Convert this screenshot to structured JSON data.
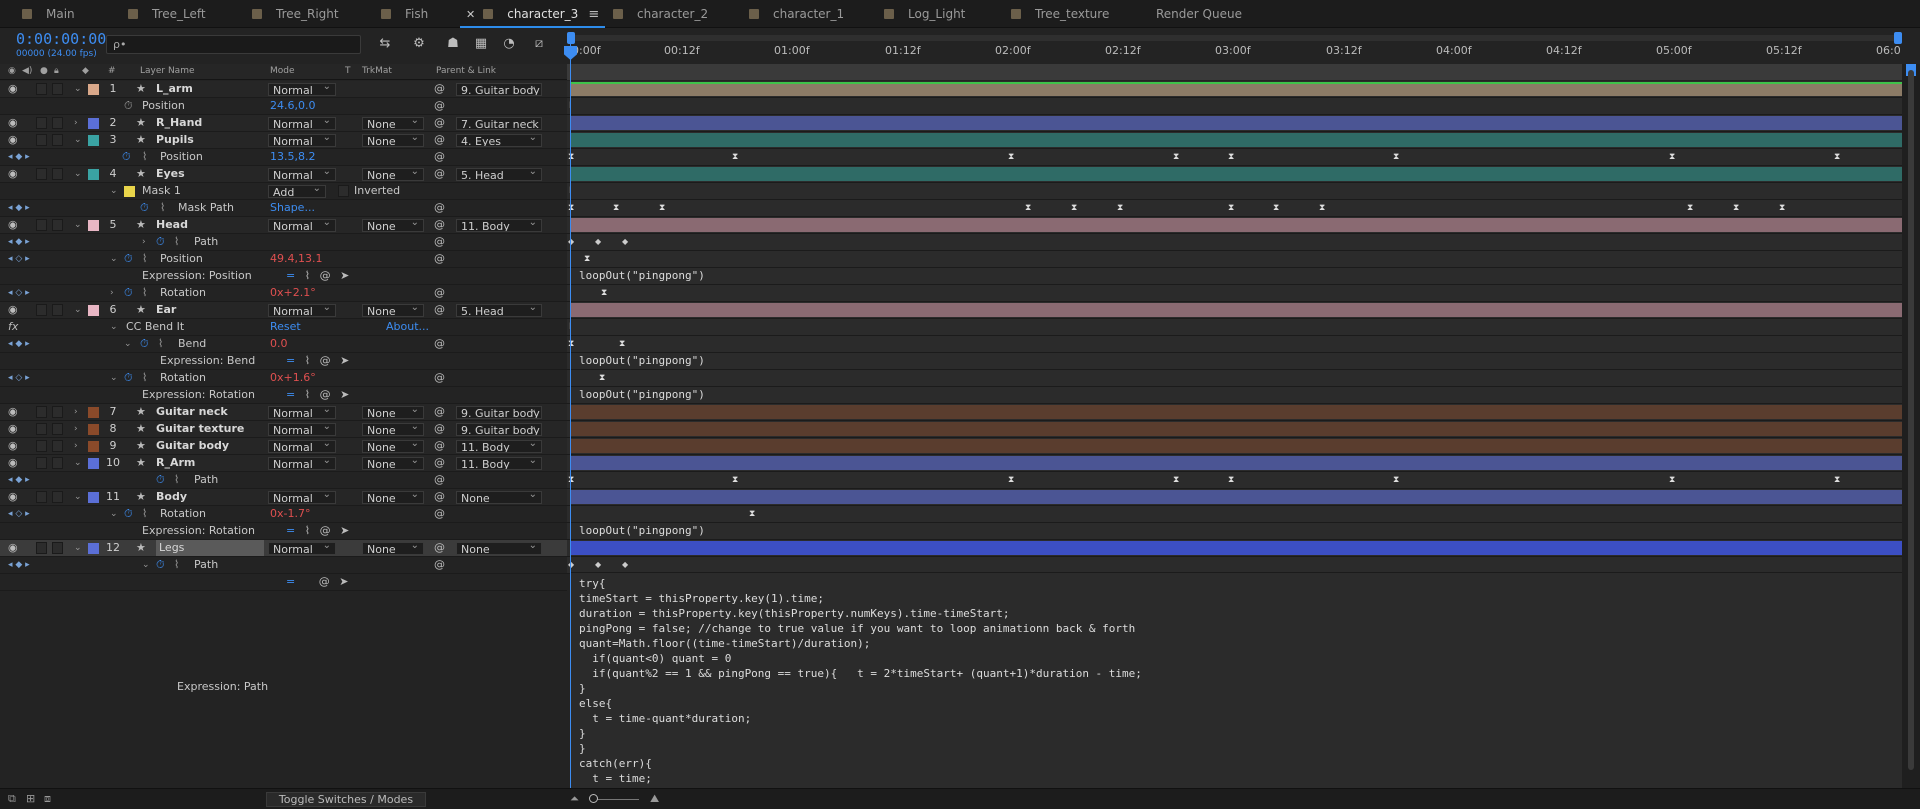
{
  "tabs": [
    {
      "label": "Main"
    },
    {
      "label": "Tree_Left"
    },
    {
      "label": "Tree_Right"
    },
    {
      "label": "Fish"
    },
    {
      "label": "character_3"
    },
    {
      "label": "character_2"
    },
    {
      "label": "character_1"
    },
    {
      "label": "Log_Light"
    },
    {
      "label": "Tree_texture"
    },
    {
      "label": "Render Queue"
    }
  ],
  "header": {
    "timecode": "0:00:00:00",
    "fps": "00000 (24.00 fps)",
    "search_placeholder": "ρ•"
  },
  "columns": {
    "hash": "#",
    "layer_name": "Layer Name",
    "mode": "Mode",
    "t": "T",
    "trkmat": "TrkMat",
    "parent": "Parent & Link"
  },
  "ruler": {
    "ticks": [
      "0:00f",
      "00:12f",
      "01:00f",
      "01:12f",
      "02:00f",
      "02:12f",
      "03:00f",
      "03:12f",
      "04:00f",
      "04:12f",
      "05:00f",
      "05:12f",
      "06:0"
    ]
  },
  "layers": {
    "r1": {
      "num": "1",
      "name": "L_arm",
      "mode": "Normal",
      "parent": "9. Guitar body",
      "color": "#d9a88a"
    },
    "r1p": {
      "name": "Position",
      "value": "24.6,0.0"
    },
    "r2": {
      "num": "2",
      "name": "R_Hand",
      "mode": "Normal",
      "trk": "None",
      "parent": "7. Guitar neck",
      "color": "#5b6fd6"
    },
    "r3": {
      "num": "3",
      "name": "Pupils",
      "mode": "Normal",
      "trk": "None",
      "parent": "4. Eyes",
      "color": "#3aa3a3"
    },
    "r3p": {
      "name": "Position",
      "value": "13.5,8.2"
    },
    "r4": {
      "num": "4",
      "name": "Eyes",
      "mode": "Normal",
      "trk": "None",
      "parent": "5. Head",
      "color": "#3aa3a3"
    },
    "r4m": {
      "name": "Mask 1",
      "mode": "Add",
      "inverted": "Inverted"
    },
    "r4mp": {
      "name": "Mask Path",
      "value": "Shape..."
    },
    "r5": {
      "num": "5",
      "name": "Head",
      "mode": "Normal",
      "trk": "None",
      "parent": "11. Body",
      "color": "#e8b6c4"
    },
    "r5a": {
      "name": "Path"
    },
    "r5b": {
      "name": "Position",
      "value": "49.4,13.1"
    },
    "r5c": {
      "label": "Expression: Position"
    },
    "r5d": {
      "name": "Rotation",
      "value": "0x+2.1°"
    },
    "r6": {
      "num": "6",
      "name": "Ear",
      "mode": "Normal",
      "trk": "None",
      "parent": "5. Head",
      "color": "#e8b6c4"
    },
    "r6fx": {
      "name": "CC Bend It",
      "reset": "Reset",
      "about": "About..."
    },
    "r6a": {
      "name": "Bend",
      "value": "0.0"
    },
    "r6b": {
      "label": "Expression: Bend"
    },
    "r6c": {
      "name": "Rotation",
      "value": "0x+1.6°"
    },
    "r6d": {
      "label": "Expression: Rotation"
    },
    "r7": {
      "num": "7",
      "name": "Guitar neck",
      "mode": "Normal",
      "trk": "None",
      "parent": "9. Guitar body",
      "color": "#8a4a2a"
    },
    "r8": {
      "num": "8",
      "name": "Guitar texture",
      "mode": "Normal",
      "trk": "None",
      "parent": "9. Guitar body",
      "color": "#8a4a2a"
    },
    "r9": {
      "num": "9",
      "name": "Guitar body",
      "mode": "Normal",
      "trk": "None",
      "parent": "11. Body",
      "color": "#8a4a2a"
    },
    "r10": {
      "num": "10",
      "name": "R_Arm",
      "mode": "Normal",
      "trk": "None",
      "parent": "11. Body",
      "color": "#5b6fd6"
    },
    "r10a": {
      "name": "Path"
    },
    "r11": {
      "num": "11",
      "name": "Body",
      "mode": "Normal",
      "trk": "None",
      "parent": "None",
      "color": "#5b6fd6"
    },
    "r11a": {
      "name": "Rotation",
      "value": "0x-1.7°"
    },
    "r11b": {
      "label": "Expression: Rotation"
    },
    "r12": {
      "num": "12",
      "name": "Legs",
      "mode": "Normal",
      "trk": "None",
      "parent": "None",
      "color": "#5b6fd6"
    },
    "r12a": {
      "name": "Path"
    },
    "expr_path_label": "Expression: Path"
  },
  "expressions": {
    "loop": "loopOut(\"pingpong\")"
  },
  "code": [
    "try{",
    "timeStart = thisProperty.key(1).time;",
    "duration = thisProperty.key(thisProperty.numKeys).time-timeStart;",
    "pingPong = false; //change to true value if you want to loop animationn back & forth",
    "quant=Math.floor((time-timeStart)/duration);",
    "  if(quant<0) quant = 0",
    "  if(quant%2 == 1 && pingPong == true){   t = 2*timeStart+ (quant+1)*duration - time;",
    "}",
    "else{",
    "  t = time-quant*duration;",
    "}",
    "}",
    "catch(err){",
    "  t = time;"
  ],
  "footer": {
    "toggle": "Toggle Switches / Modes"
  },
  "colors": {
    "accent": "#3d8df2",
    "tan": "#8c7b66",
    "blue": "#4b5594",
    "teal": "#2f6b66",
    "pink": "#8a6a72",
    "brown": "#5a3d2e",
    "legs": "#3c4fc4"
  }
}
